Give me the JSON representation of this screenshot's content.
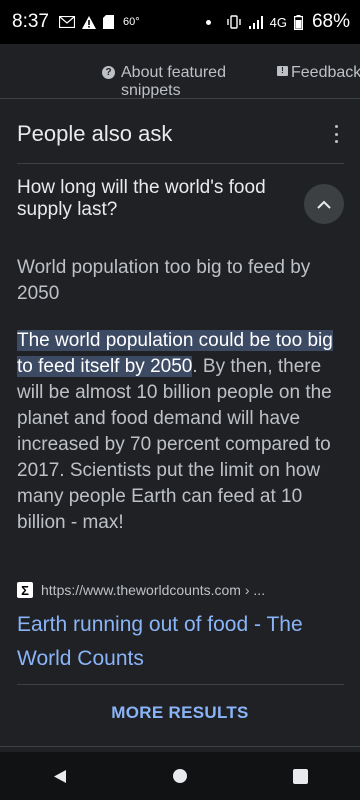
{
  "status_bar": {
    "time": "8:37",
    "temperature": "60°",
    "network": "4G",
    "battery": "68%",
    "icons": [
      "mail-icon",
      "warning-icon",
      "sd-card-icon",
      "dot-icon",
      "vibrate-icon",
      "signal-icon",
      "battery-icon"
    ]
  },
  "snippet_bar": {
    "about_label": "About featured snippets",
    "feedback_label": "Feedback"
  },
  "paa": {
    "title": "People also ask",
    "question": "How long will the world's food supply last?",
    "answer_heading": "World population too big to feed by 2050",
    "answer_highlight": "The world population could be too big to feed itself by 2050",
    "answer_rest": ". By then, there will be almost 10 billion people on the planet and food demand will have increased by 70 percent compared to 2017. Scientists put the limit on how many people Earth can feed at 10 billion - max!",
    "source_url": "https://www.theworldcounts.com › ...",
    "source_favicon": "Σ",
    "result_title": "Earth running out of food - The World Counts",
    "more_results_label": "MORE RESULTS"
  },
  "colors": {
    "background": "#202124",
    "text": "#e8eaed",
    "muted_text": "#bdc1c6",
    "link": "#8ab4f8",
    "highlight": "#3c4a64"
  }
}
